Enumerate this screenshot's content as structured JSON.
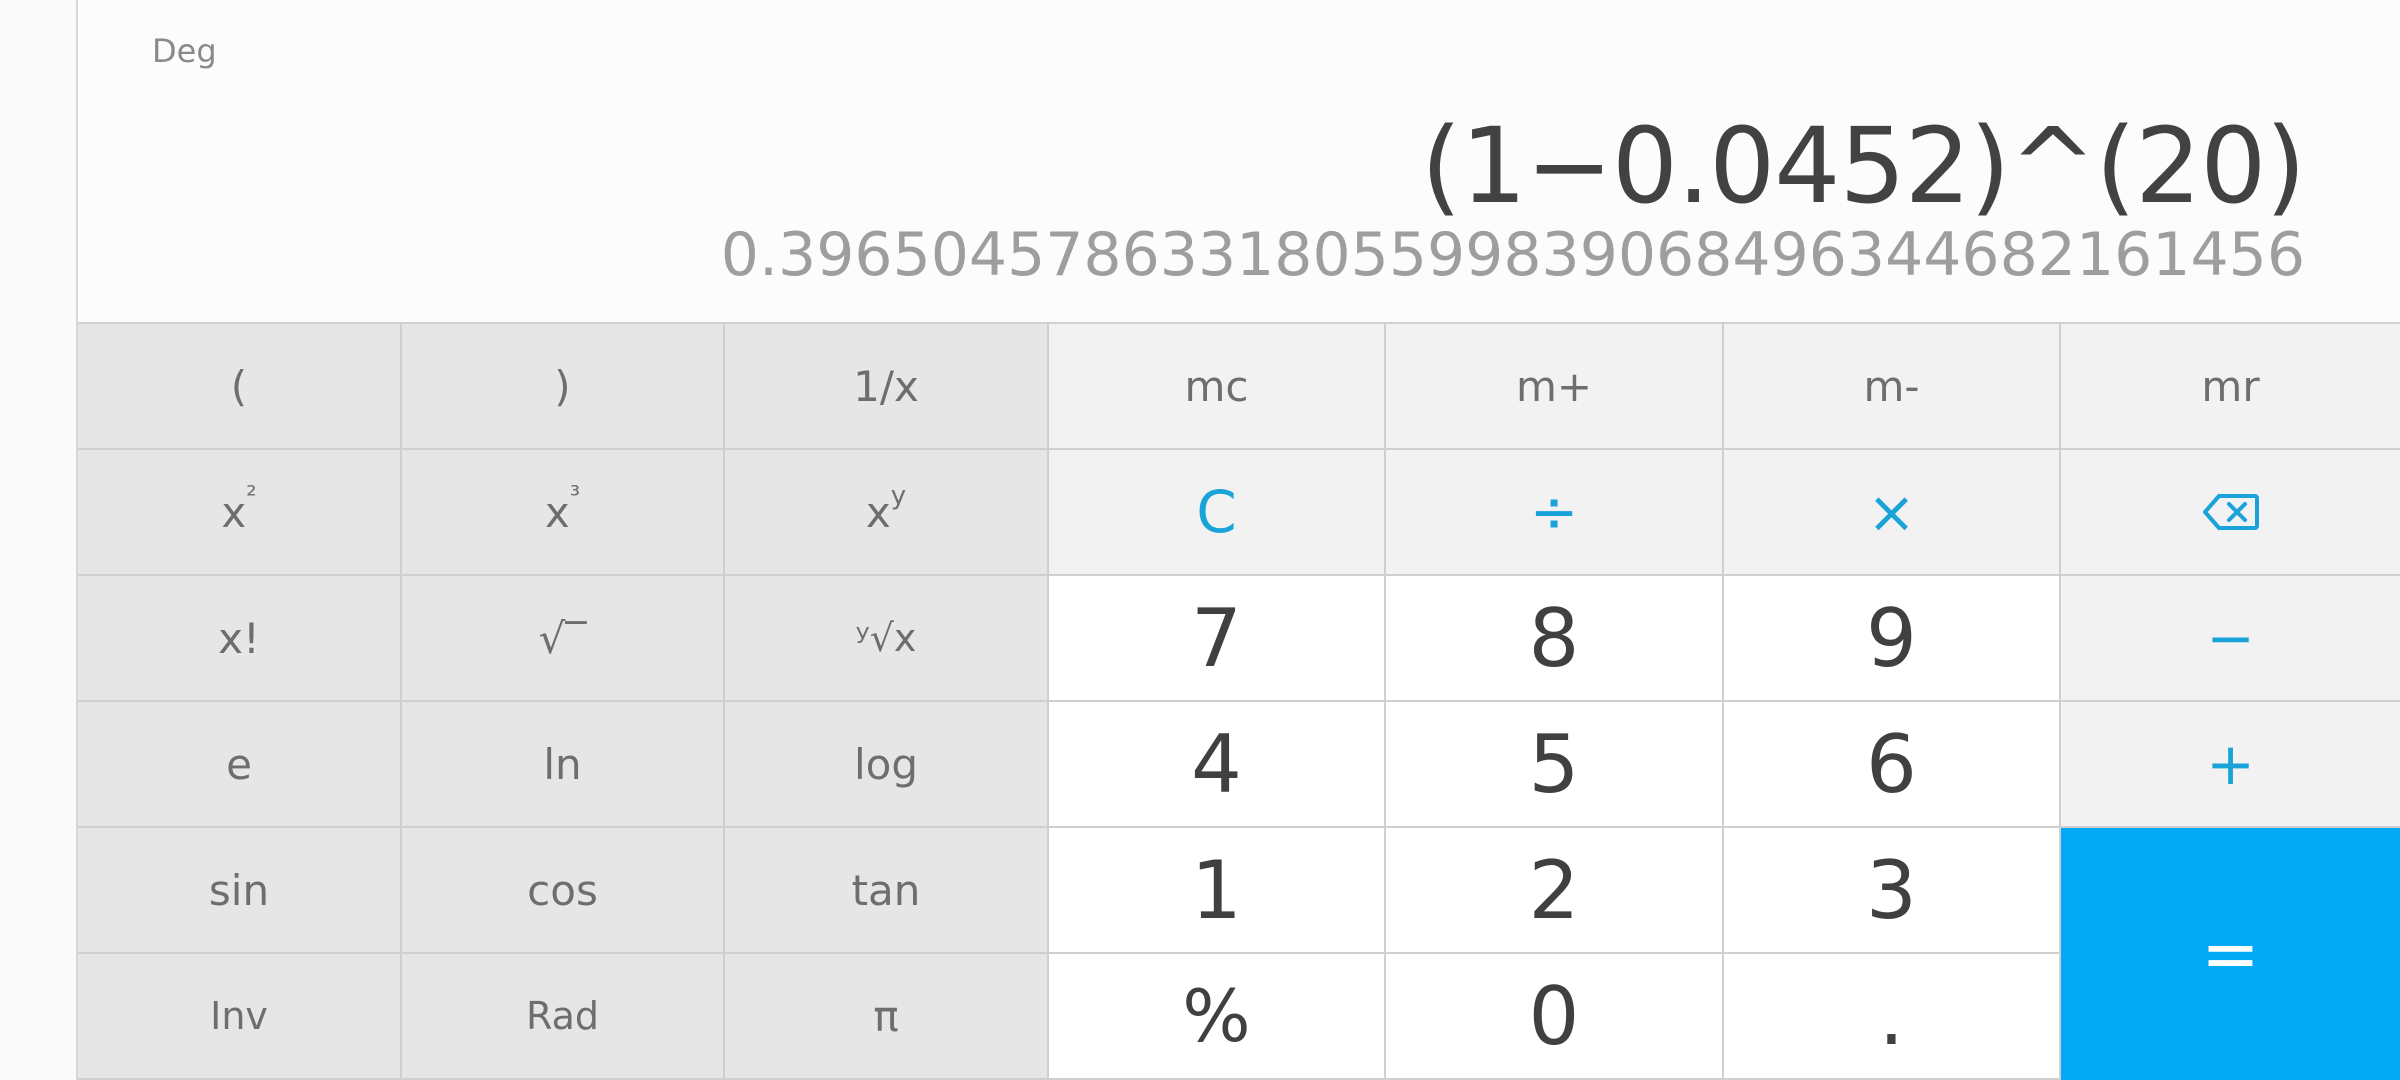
{
  "display": {
    "angle_mode": "Deg",
    "expression": "(1−0.0452)^(20)",
    "result": "0.3965045786331805599839068496344682161456"
  },
  "keys": {
    "open_paren": "(",
    "close_paren": ")",
    "reciprocal": "1/x",
    "mc": "mc",
    "m_plus": "m+",
    "m_minus": "m-",
    "mr": "mr",
    "square_base": "x",
    "square_exp": "²",
    "cube_base": "x",
    "cube_exp": "³",
    "power_base": "x",
    "power_exp": "y",
    "clear": "C",
    "divide": "÷",
    "multiply": "×",
    "factorial": "x!",
    "sqrt": "√‾",
    "yroot": "ʸ√x",
    "seven": "7",
    "eight": "8",
    "nine": "9",
    "minus": "−",
    "e": "e",
    "ln": "ln",
    "log": "log",
    "four": "4",
    "five": "5",
    "six": "6",
    "plus": "+",
    "sin": "sin",
    "cos": "cos",
    "tan": "tan",
    "one": "1",
    "two": "2",
    "three": "3",
    "equals": "=",
    "inv": "Inv",
    "rad": "Rad",
    "pi": "π",
    "percent": "%",
    "zero": "0",
    "decimal": "."
  },
  "colors": {
    "accent": "#03a9f4",
    "operator_text": "#1aa3d9",
    "scientific_bg": "#e6e6e6",
    "operator_bg": "#f2f2f2",
    "number_bg": "#ffffff"
  },
  "icons": {
    "backspace": "backspace-icon"
  }
}
